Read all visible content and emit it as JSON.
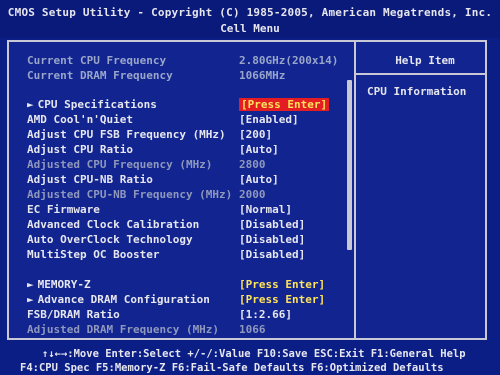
{
  "header": {
    "title": "CMOS Setup Utility - Copyright (C) 1985-2005, American Megatrends, Inc.",
    "subtitle": "Cell Menu"
  },
  "help": {
    "title": "Help Item",
    "text": "CPU Information"
  },
  "settings": [
    {
      "label": "Current CPU Frequency",
      "value": "2.80GHz(200x14)"
    },
    {
      "label": "Current DRAM Frequency",
      "value": "1066MHz"
    },
    {
      "label": "CPU Specifications",
      "value": "[Press Enter]"
    },
    {
      "label": "AMD Cool'n'Quiet",
      "value": "[Enabled]"
    },
    {
      "label": "Adjust CPU FSB Frequency (MHz)",
      "value": "[200]"
    },
    {
      "label": "Adjust CPU Ratio",
      "value": "[Auto]"
    },
    {
      "label": "Adjusted CPU Frequency (MHz)",
      "value": "2800"
    },
    {
      "label": "Adjust CPU-NB Ratio",
      "value": "[Auto]"
    },
    {
      "label": "Adjusted CPU-NB Frequency (MHz)",
      "value": "2000"
    },
    {
      "label": "EC Firmware",
      "value": "[Normal]"
    },
    {
      "label": "Advanced Clock Calibration",
      "value": "[Disabled]"
    },
    {
      "label": "Auto OverClock Technology",
      "value": "[Disabled]"
    },
    {
      "label": "MultiStep OC Booster",
      "value": "[Disabled]"
    },
    {
      "label": "MEMORY-Z",
      "value": "[Press Enter]"
    },
    {
      "label": "Advance DRAM Configuration",
      "value": "[Press Enter]"
    },
    {
      "label": "FSB/DRAM Ratio",
      "value": "[1:2.66]"
    },
    {
      "label": "Adjusted DRAM Frequency (MHz)",
      "value": "1066"
    }
  ],
  "footer": {
    "line1": "↑↓←→:Move  Enter:Select  +/-/:Value  F10:Save  ESC:Exit  F1:General Help",
    "line2": "F4:CPU Spec  F5:Memory-Z  F6:Fail-Safe Defaults  F6:Optimized Defaults"
  },
  "colors": {
    "background": "#0b1e86",
    "highlight": "#e41d22",
    "submenu_value": "#ffe35a"
  }
}
